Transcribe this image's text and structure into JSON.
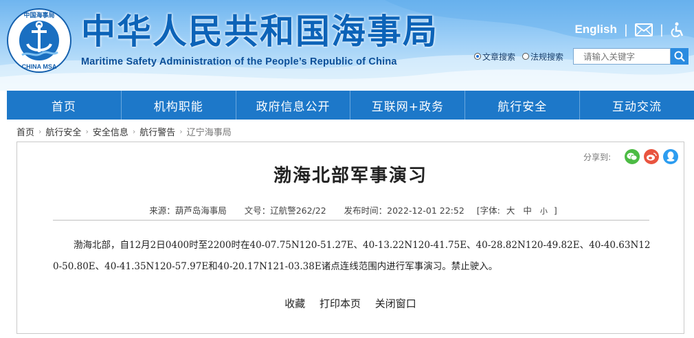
{
  "header": {
    "title": "中华人民共和国海事局",
    "subtitle": "Maritime Safety Administration of the People’s Republic of China",
    "emblem_text_top": "中国海事局",
    "emblem_text_bottom": "CHINA MSA",
    "english_label": "English",
    "separator": "|"
  },
  "search": {
    "options": [
      {
        "label": "文章搜索",
        "selected": true
      },
      {
        "label": "法规搜索",
        "selected": false
      }
    ],
    "placeholder": "请输入关键字"
  },
  "nav": {
    "items": [
      "首页",
      "机构职能",
      "政府信息公开",
      "互联网+政务",
      "航行安全",
      "互动交流"
    ]
  },
  "breadcrumb": {
    "items": [
      "首页",
      "航行安全",
      "安全信息",
      "航行警告",
      "辽宁海事局"
    ],
    "arrow": "›"
  },
  "share": {
    "label": "分享到:"
  },
  "article": {
    "title": "渤海北部军事演习",
    "source": "来源：葫芦岛海事局",
    "doc_no": "文号：辽航警262/22",
    "published": "发布时间：2022-12-01 22:52",
    "font_size_label": "[字体:",
    "font_large": "大",
    "font_medium": "中",
    "font_small": "小",
    "font_close": "]",
    "body": "渤海北部，自12月2日0400时至2200时在40-07.75N120-51.27E、40-13.22N120-41.75E、40-28.82N120-49.82E、40-40.63N120-50.80E、40-41.35N120-57.97E和40-20.17N121-03.38E诸点连线范围内进行军事演习。禁止驶入。"
  },
  "actions": {
    "favorite": "收藏",
    "print": "打印本页",
    "close": "关闭窗口"
  },
  "colors": {
    "nav_bg": "#1d78c9",
    "title_blue": "#0c63b8",
    "wechat": "#4cbb44",
    "weibo": "#e9543f",
    "qq": "#2d9df0"
  }
}
